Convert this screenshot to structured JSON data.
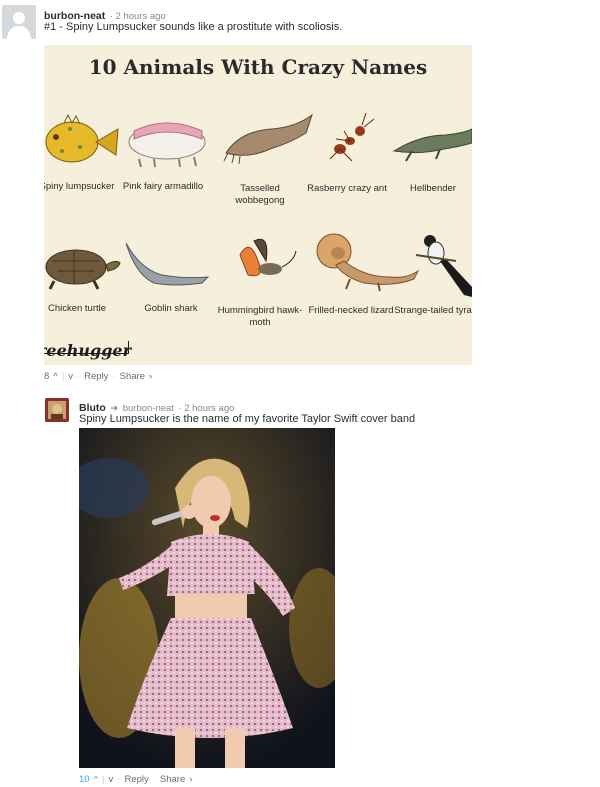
{
  "comment1": {
    "author": "burbon-neat",
    "time": "2 hours ago",
    "text": "#1 - Spiny Lumpsucker sounds like a prostitute with scoliosis.",
    "image": {
      "title": "10 Animals With Crazy Names",
      "animals": [
        "Spiny lumpsucker",
        "Pink fairy armadillo",
        "Tasselled wobbegong",
        "Rasberry crazy ant",
        "Hellbender",
        "Chicken turtle",
        "Goblin shark",
        "Hummingbird hawk-moth",
        "Frilled-necked lizard",
        "Strange-tailed tyrant"
      ],
      "brand": "reehugger"
    },
    "votes": "8",
    "reply": "Reply",
    "share": "Share"
  },
  "comment2": {
    "author": "Bluto",
    "reply_to": "burbon-neat",
    "time": "2 hours ago",
    "text": "Spiny Lumpsucker is the name of my favorite Taylor Swift cover band",
    "votes": "10",
    "reply": "Reply",
    "share": "Share"
  },
  "colors": {
    "accent": "#2e9fff",
    "meta": "#656c7a",
    "bg_infographic": "#f6efdb"
  }
}
